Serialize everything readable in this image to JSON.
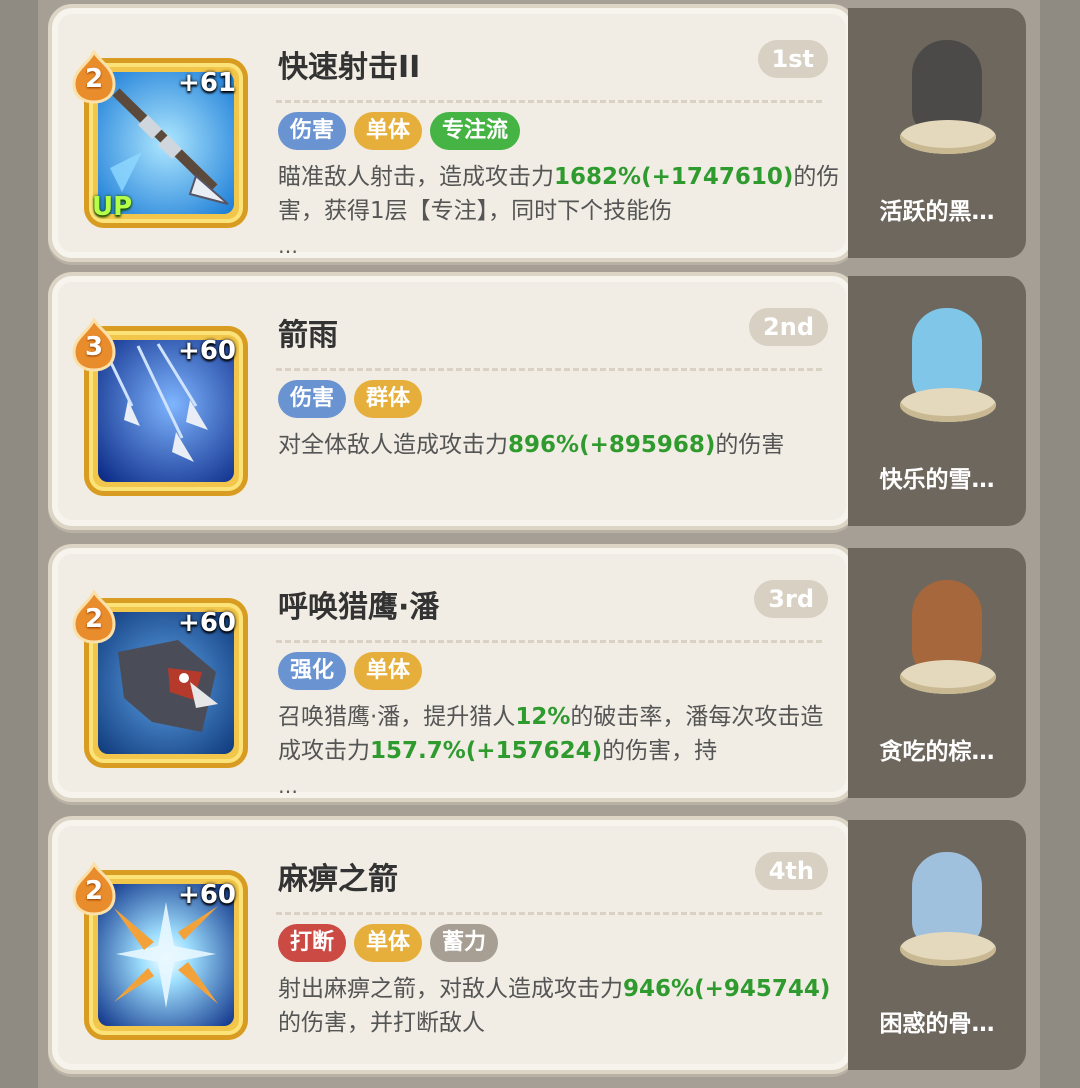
{
  "colors": {
    "tag_damage": "#6a93d1",
    "tag_single": "#e6ae3a",
    "tag_focus": "#46b345",
    "tag_interrupt": "#cc4a44",
    "tag_charge": "#a79f94",
    "level_badge": "#e98d2c",
    "highlight_green": "#2f9b2f"
  },
  "skills": [
    {
      "level": "2",
      "bonus": "+61",
      "up_label": "UP",
      "icon": "arrow-skill-icon",
      "title": "快速射击II",
      "rank": "1st",
      "tags": [
        "伤害",
        "单体",
        "专注流"
      ],
      "desc_parts": [
        "瞄准敌人射击，造成攻击力",
        "1682%",
        "(+1747610)",
        "的伤害，获得1层【专注】，同时下个技能伤"
      ],
      "ellipsis": "…",
      "pet_name": "活跃的黑…"
    },
    {
      "level": "3",
      "bonus": "+60",
      "icon": "arrow-rain-icon",
      "title": "箭雨",
      "rank": "2nd",
      "tags": [
        "伤害",
        "群体"
      ],
      "desc_parts": [
        "对全体敌人造成攻击力",
        "896%",
        "(+895968)",
        "的伤害"
      ],
      "pet_name": "快乐的雪…"
    },
    {
      "level": "2",
      "bonus": "+60",
      "icon": "falcon-icon",
      "title": "呼唤猎鹰·潘",
      "rank": "3rd",
      "tags": [
        "强化",
        "单体"
      ],
      "desc_parts": [
        "召唤猎鹰·潘，提升猎人",
        "12%",
        "的破击率，潘每次攻击造成攻击力",
        "157.7%",
        "(+157624)",
        "的伤害，持"
      ],
      "ellipsis": "…",
      "pet_name": "贪吃的棕…"
    },
    {
      "level": "2",
      "bonus": "+60",
      "icon": "paralysis-arrow-icon",
      "title": "麻痹之箭",
      "rank": "4th",
      "tags": [
        "打断",
        "单体",
        "蓄力"
      ],
      "desc_parts": [
        "射出麻痹之箭，对敌人造成攻击力",
        "946%",
        "(+945744)",
        "的伤害，并打断敌人"
      ],
      "pet_name": "困惑的骨…"
    }
  ]
}
